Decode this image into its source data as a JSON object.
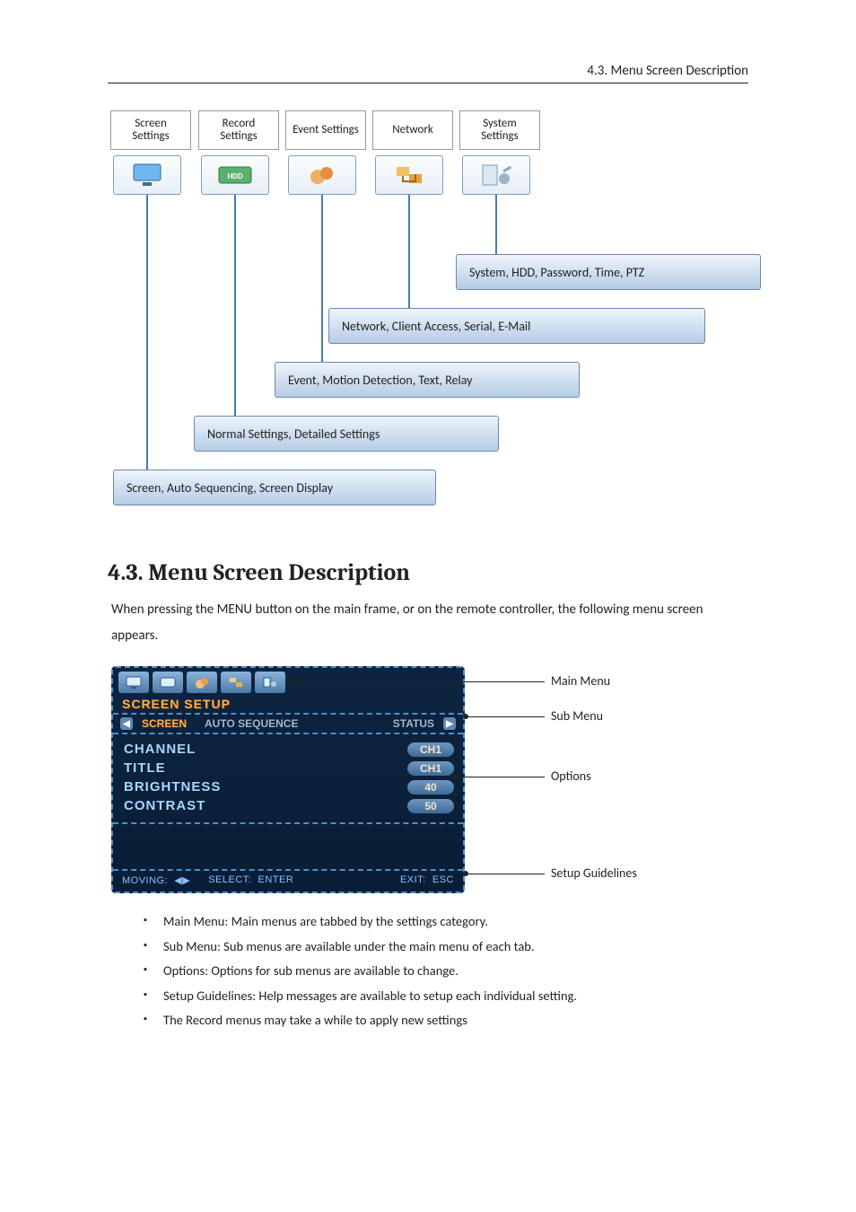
{
  "header": {
    "running": "4.3. Menu Screen Description"
  },
  "tree": {
    "labels": {
      "screen": "Screen Settings",
      "record": "Record Settings",
      "event": "Event Settings",
      "network": "Network",
      "system": "System Settings"
    },
    "hdd_badge": "HDD",
    "descs": {
      "system": "System, HDD, Password, Time, PTZ",
      "network": "Network, Client Access, Serial, E-Mail",
      "event": "Event, Motion Detection, Text, Relay",
      "record": "Normal Settings, Detailed Settings",
      "screen": "Screen, Auto Sequencing, Screen Display"
    }
  },
  "section": {
    "heading": "4.3. Menu Screen Description",
    "intro": "When pressing the MENU button on the main frame, or on the remote controller, the following menu screen appears."
  },
  "dvr": {
    "title": "SCREEN SETUP",
    "sub": {
      "sel": "SCREEN",
      "a": "AUTO SEQUENCE",
      "b": "STATUS"
    },
    "opts": [
      {
        "k": "CHANNEL",
        "v": "CH1"
      },
      {
        "k": "TITLE",
        "v": "CH1"
      },
      {
        "k": "BRIGHTNESS",
        "v": "40"
      },
      {
        "k": "CONTRAST",
        "v": "50"
      }
    ],
    "guide": {
      "moving": "MOVING:",
      "moving_icon": "◀▶",
      "select": "SELECT:",
      "select_v": "ENTER",
      "exit": "EXIT:",
      "exit_v": "ESC"
    },
    "annots": {
      "main": "Main Menu",
      "sub": "Sub Menu",
      "opt": "Options",
      "gui": "Setup Guidelines"
    }
  },
  "bullets": [
    "Main Menu: Main menus are tabbed by the settings category.",
    "Sub Menu: Sub menus are available under the main menu of each tab.",
    "Options: Options for sub menus are available to change.",
    "Setup Guidelines: Help messages are available to setup each individual setting.",
    "The Record menus may take a while to apply new settings"
  ]
}
